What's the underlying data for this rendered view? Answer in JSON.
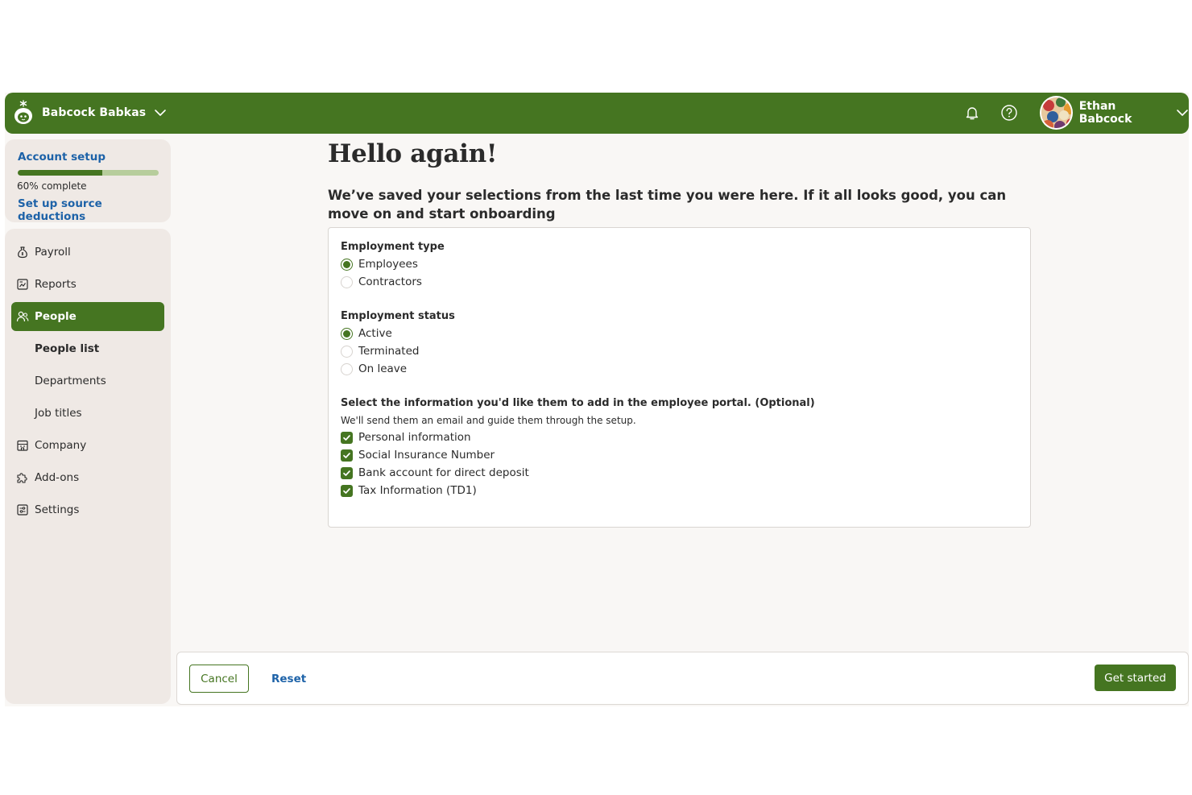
{
  "header": {
    "company_name": "Babcock Babkas",
    "user_name": "Ethan Babcock",
    "icons": [
      "bell-icon",
      "help-icon",
      "chevron-down-icon"
    ]
  },
  "setup": {
    "title": "Account setup",
    "progress_percent": 60,
    "progress_text": "60% complete",
    "next_step": "Set up source deductions"
  },
  "nav": {
    "payroll": "Payroll",
    "reports": "Reports",
    "people": "People",
    "people_list": "People list",
    "departments": "Departments",
    "job_titles": "Job titles",
    "company": "Company",
    "addons": "Add-ons",
    "settings": "Settings"
  },
  "main": {
    "title": "Hello again!",
    "lead": "We’ve saved your selections from the last time you were here. If it all looks good, you can move on and start onboarding"
  },
  "form": {
    "employment_type": {
      "label": "Employment type",
      "options": [
        {
          "label": "Employees",
          "selected": true
        },
        {
          "label": "Contractors",
          "selected": false
        }
      ]
    },
    "employment_status": {
      "label": "Employment status",
      "options": [
        {
          "label": "Active",
          "selected": true
        },
        {
          "label": "Terminated",
          "selected": false
        },
        {
          "label": "On leave",
          "selected": false
        }
      ]
    },
    "portal": {
      "label": "Select the information you'd like them to add in the employee portal. (Optional)",
      "hint": "We'll send them an email and guide them through the setup.",
      "options": [
        {
          "label": "Personal information",
          "checked": true
        },
        {
          "label": "Social Insurance Number",
          "checked": true
        },
        {
          "label": "Bank account for direct deposit",
          "checked": true
        },
        {
          "label": "Tax Information (TD1)",
          "checked": true
        }
      ]
    }
  },
  "footer": {
    "cancel": "Cancel",
    "reset": "Reset",
    "get_started": "Get started"
  },
  "colors": {
    "brand_green": "#457521",
    "link_blue": "#1d62a8",
    "sidebar_bg": "#efe9e5",
    "page_bg": "#f9f7f5"
  }
}
